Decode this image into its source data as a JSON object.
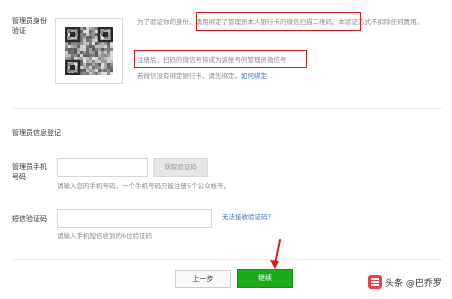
{
  "identity": {
    "label": "管理员身份验证",
    "desc_prefix": "为了验证你的身份，",
    "desc_highlight": "请用绑定了管理员本人银行卡的微信扫描二维码",
    "desc_suffix": "。本验证方式不扣除任何费用。",
    "desc_line2": "费用。",
    "note_highlight": "注册后，扫码的微信号将成为该帐号的管理员微信号",
    "unbound_text": "若微信没有绑定银行卡，请先绑定。",
    "bind_link": "如何绑定"
  },
  "section": {
    "title": "管理员信息登记"
  },
  "phone": {
    "label": "管理员手机号码",
    "input_value": "",
    "get_code_button": "获取验证码",
    "hint": "请输入您的手机号码，一个手机号码只能注册5个公众帐号。"
  },
  "sms": {
    "label": "短信验证码",
    "input_value": "",
    "no_code_link": "无法接收验证码？",
    "hint": "请输入手机短信收到的6位验证码"
  },
  "actions": {
    "prev_label": "上一步",
    "continue_label": "继续"
  },
  "watermark": {
    "text": "头条 @巴乔罗"
  },
  "colors": {
    "highlight_border": "#d91e18",
    "primary_green": "#1aad19",
    "link_blue": "#3a76c4"
  }
}
